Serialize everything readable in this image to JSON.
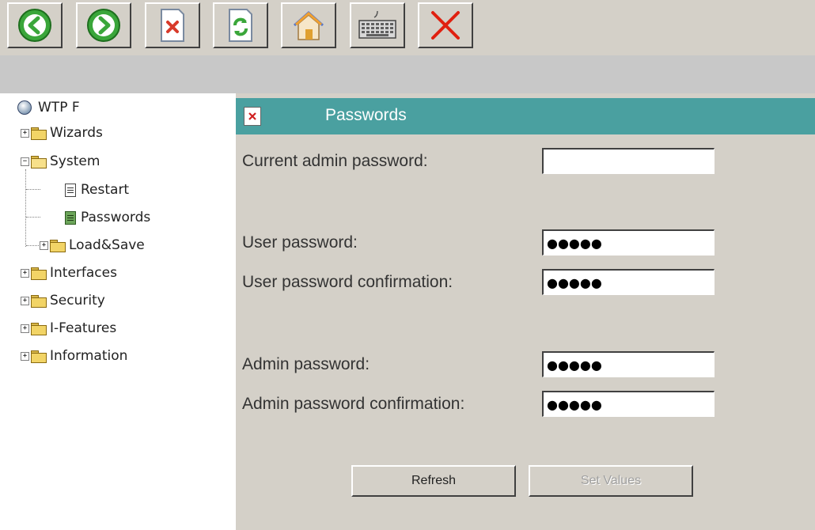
{
  "toolbar": {
    "buttons": [
      {
        "icon": "back-arrow-icon",
        "color": "#3aa63a"
      },
      {
        "icon": "forward-arrow-icon",
        "color": "#3aa63a"
      },
      {
        "icon": "close-document-icon",
        "color": "#d83a2a"
      },
      {
        "icon": "refresh-document-icon",
        "color": "#3aa63a"
      },
      {
        "icon": "home-icon",
        "color": "#e0a030"
      },
      {
        "icon": "keyboard-icon",
        "color": "#909090"
      },
      {
        "icon": "close-x-icon",
        "color": "#e02010"
      }
    ]
  },
  "tree": {
    "root": "WTP F",
    "items": [
      {
        "label": "Wizards"
      },
      {
        "label": "System"
      },
      {
        "label": "Restart"
      },
      {
        "label": "Passwords"
      },
      {
        "label": "Load&Save"
      },
      {
        "label": "Interfaces"
      },
      {
        "label": "Security"
      },
      {
        "label": "I-Features"
      },
      {
        "label": "Information"
      }
    ]
  },
  "panel": {
    "title": "Passwords",
    "header_color": "#4aa0a0",
    "fields": [
      {
        "label": "Current admin password:",
        "value": ""
      },
      {
        "label": "User password:",
        "value": "●●●●●"
      },
      {
        "label": "User password confirmation:",
        "value": "●●●●●"
      },
      {
        "label": "Admin password:",
        "value": "●●●●●"
      },
      {
        "label": "Admin password confirmation:",
        "value": "●●●●●"
      }
    ],
    "refresh_label": "Refresh",
    "set_values_label": "Set Values"
  }
}
